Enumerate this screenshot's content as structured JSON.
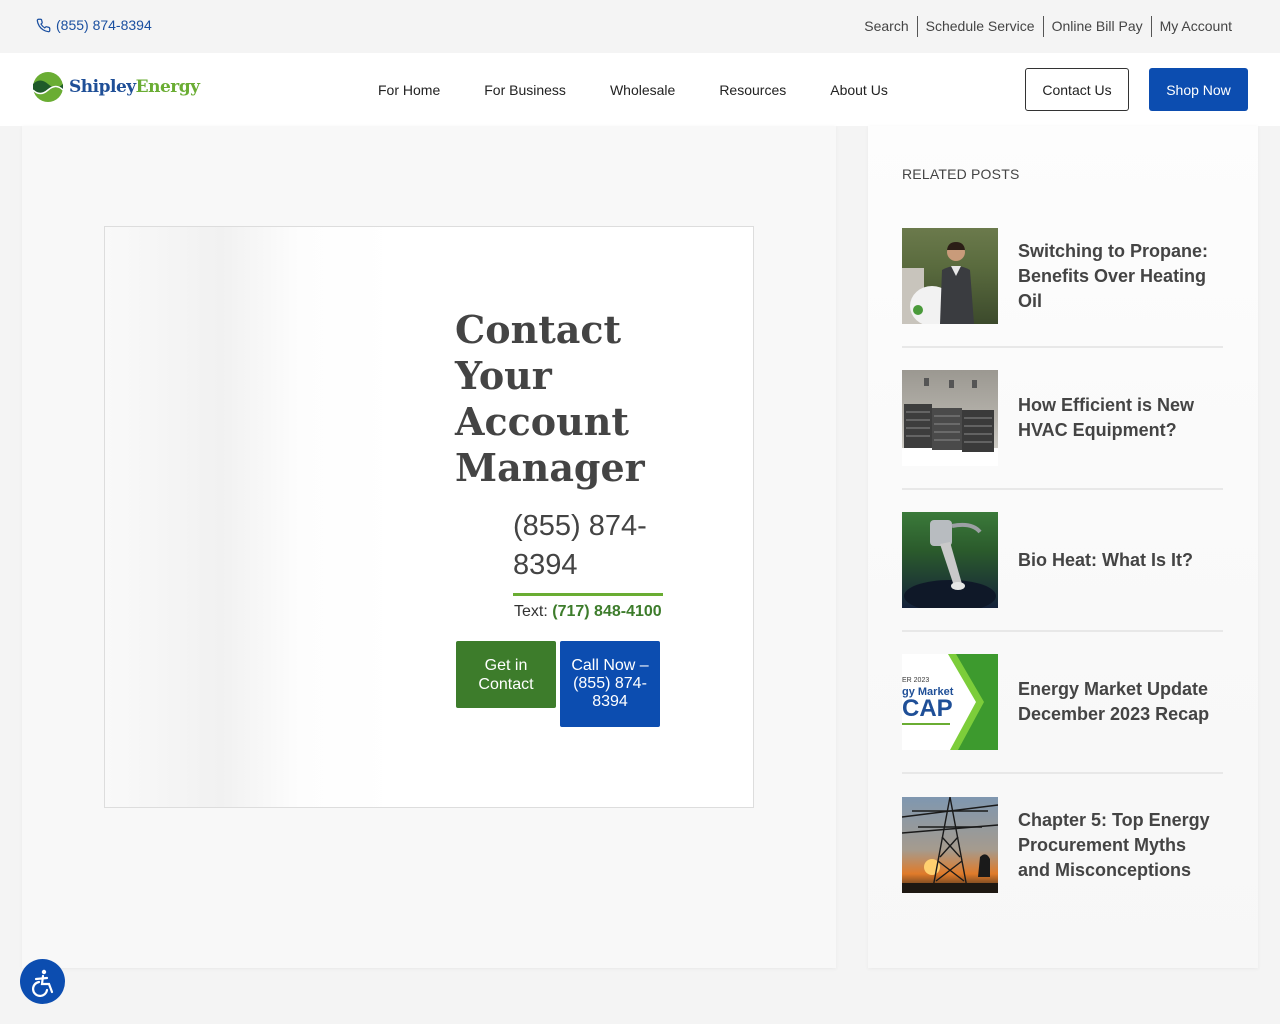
{
  "topbar": {
    "phone": "(855) 874-8394",
    "links": [
      "Search",
      "Schedule Service",
      "Online Bill Pay",
      "My Account"
    ]
  },
  "header": {
    "logo_word1": "Shipley",
    "logo_word2": "Energy",
    "nav": [
      "For Home",
      "For Business",
      "Wholesale",
      "Resources",
      "About Us"
    ],
    "contact_button": "Contact Us",
    "shop_button": "Shop Now"
  },
  "contact": {
    "title": "Contact Your Account Manager",
    "phone": "(855) 874-8394",
    "text_label": "Text:",
    "text_number": "(717) 848-4100",
    "get_in_contact": "Get in Contact",
    "call_now": "Call Now – (855) 874-8394"
  },
  "sidebar": {
    "heading": "RELATED POSTS",
    "posts": [
      {
        "title": "Switching to Propane: Benefits Over Heating Oil"
      },
      {
        "title": "How Efficient is New HVAC Equipment?"
      },
      {
        "title": "Bio Heat: What Is It?"
      },
      {
        "title": "Energy Market Update December 2023 Recap"
      },
      {
        "title": "Chapter 5: Top Energy Procurement Myths and Misconceptions"
      }
    ],
    "thumb4_line1": "ER 2023",
    "thumb4_line2": "gy Market",
    "thumb4_line3": "CAP"
  },
  "colors": {
    "brand_blue": "#0c4db0",
    "brand_green": "#3d7c2b",
    "accent_green": "#6aad33"
  }
}
